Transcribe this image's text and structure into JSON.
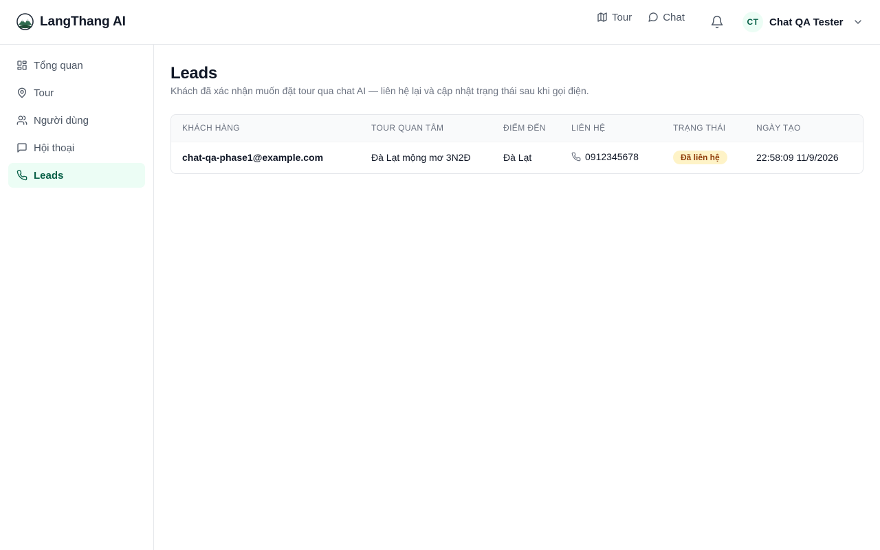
{
  "brand": {
    "name": "LangThang AI"
  },
  "topnav": [
    {
      "label": "Tour",
      "icon": "map-icon"
    },
    {
      "label": "Chat",
      "icon": "chat-bubble-icon"
    }
  ],
  "user": {
    "initials": "CT",
    "name": "Chat QA Tester"
  },
  "sidebar": {
    "items": [
      {
        "label": "Tổng quan",
        "icon": "dashboard-grid-icon",
        "active": false
      },
      {
        "label": "Tour",
        "icon": "map-pin-icon",
        "active": false
      },
      {
        "label": "Người dùng",
        "icon": "users-icon",
        "active": false
      },
      {
        "label": "Hội thoại",
        "icon": "message-square-icon",
        "active": false
      },
      {
        "label": "Leads",
        "icon": "phone-icon",
        "active": true
      }
    ]
  },
  "page": {
    "title": "Leads",
    "subtitle": "Khách đã xác nhận muốn đặt tour qua chat AI — liên hệ lại và cập nhật trạng thái sau khi gọi điện."
  },
  "table": {
    "columns": [
      "Khách hàng",
      "Tour quan tâm",
      "Điểm đến",
      "Liên hệ",
      "Trạng thái",
      "Ngày tạo"
    ],
    "rows": [
      {
        "customer": "chat-qa-phase1@example.com",
        "tour": "Đà Lạt mộng mơ 3N2Đ",
        "destination": "Đà Lạt",
        "phone": "0912345678",
        "status": "Đã liên hệ",
        "created": "22:58:09 11/9/2026"
      }
    ]
  },
  "colors": {
    "accent": "#065f46",
    "accent_bg": "#ecfdf5",
    "badge_bg": "#fef3c7",
    "badge_text": "#92400e"
  }
}
